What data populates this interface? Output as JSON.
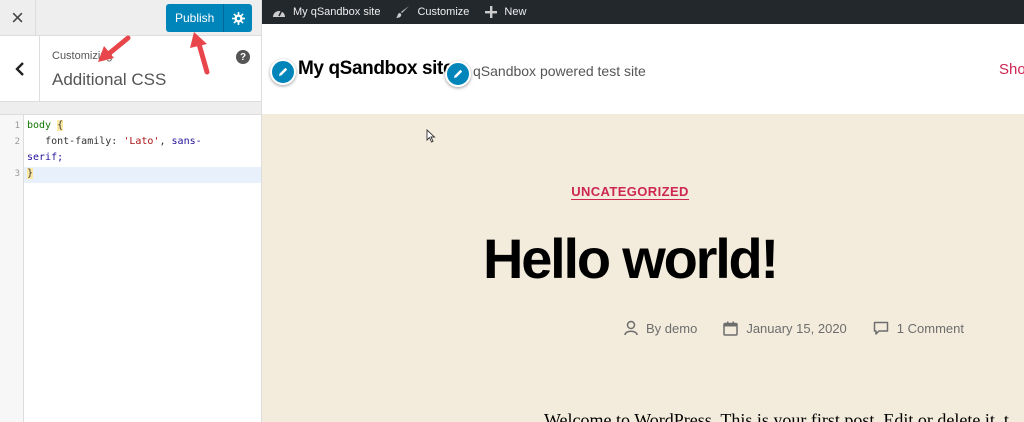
{
  "customizer": {
    "publish_label": "Publish",
    "breadcrumb": "Customizing",
    "section_title": "Additional CSS",
    "help_glyph": "?",
    "close_glyph": "×",
    "code_lines": [
      {
        "num": "1"
      },
      {
        "num": "2"
      },
      {
        "num": "3"
      }
    ],
    "code": {
      "line1_selector": "body",
      "line1_brace": "{",
      "line2_property": "font-family:",
      "line2_value_string": "'Lato'",
      "line2_comma": ",",
      "line2_value_ident": "sans-",
      "line2_wrap": "serif;",
      "line3_brace": "}"
    }
  },
  "adminbar": {
    "items": [
      {
        "label": "My qSandbox site",
        "icon": "dashboard-icon"
      },
      {
        "label": "Customize",
        "icon": "brush-icon"
      },
      {
        "label": "New",
        "icon": "plus-icon"
      }
    ]
  },
  "site": {
    "title": "My qSandbox site",
    "description": "qSandbox powered test site",
    "menu_item": "Sho"
  },
  "post": {
    "category": "UNCATEGORIZED",
    "title": "Hello world!",
    "author": "By demo",
    "date": "January 15, 2020",
    "comments": "1 Comment",
    "excerpt": "Welcome to WordPress. This is your first post. Edit or delete it, t"
  },
  "colors": {
    "primary_button": "#0085ba",
    "admin_bar": "#23282d",
    "accent": "#cd2653",
    "preview_bg": "#f3ecdc",
    "annotation_arrow": "#e8464b"
  }
}
